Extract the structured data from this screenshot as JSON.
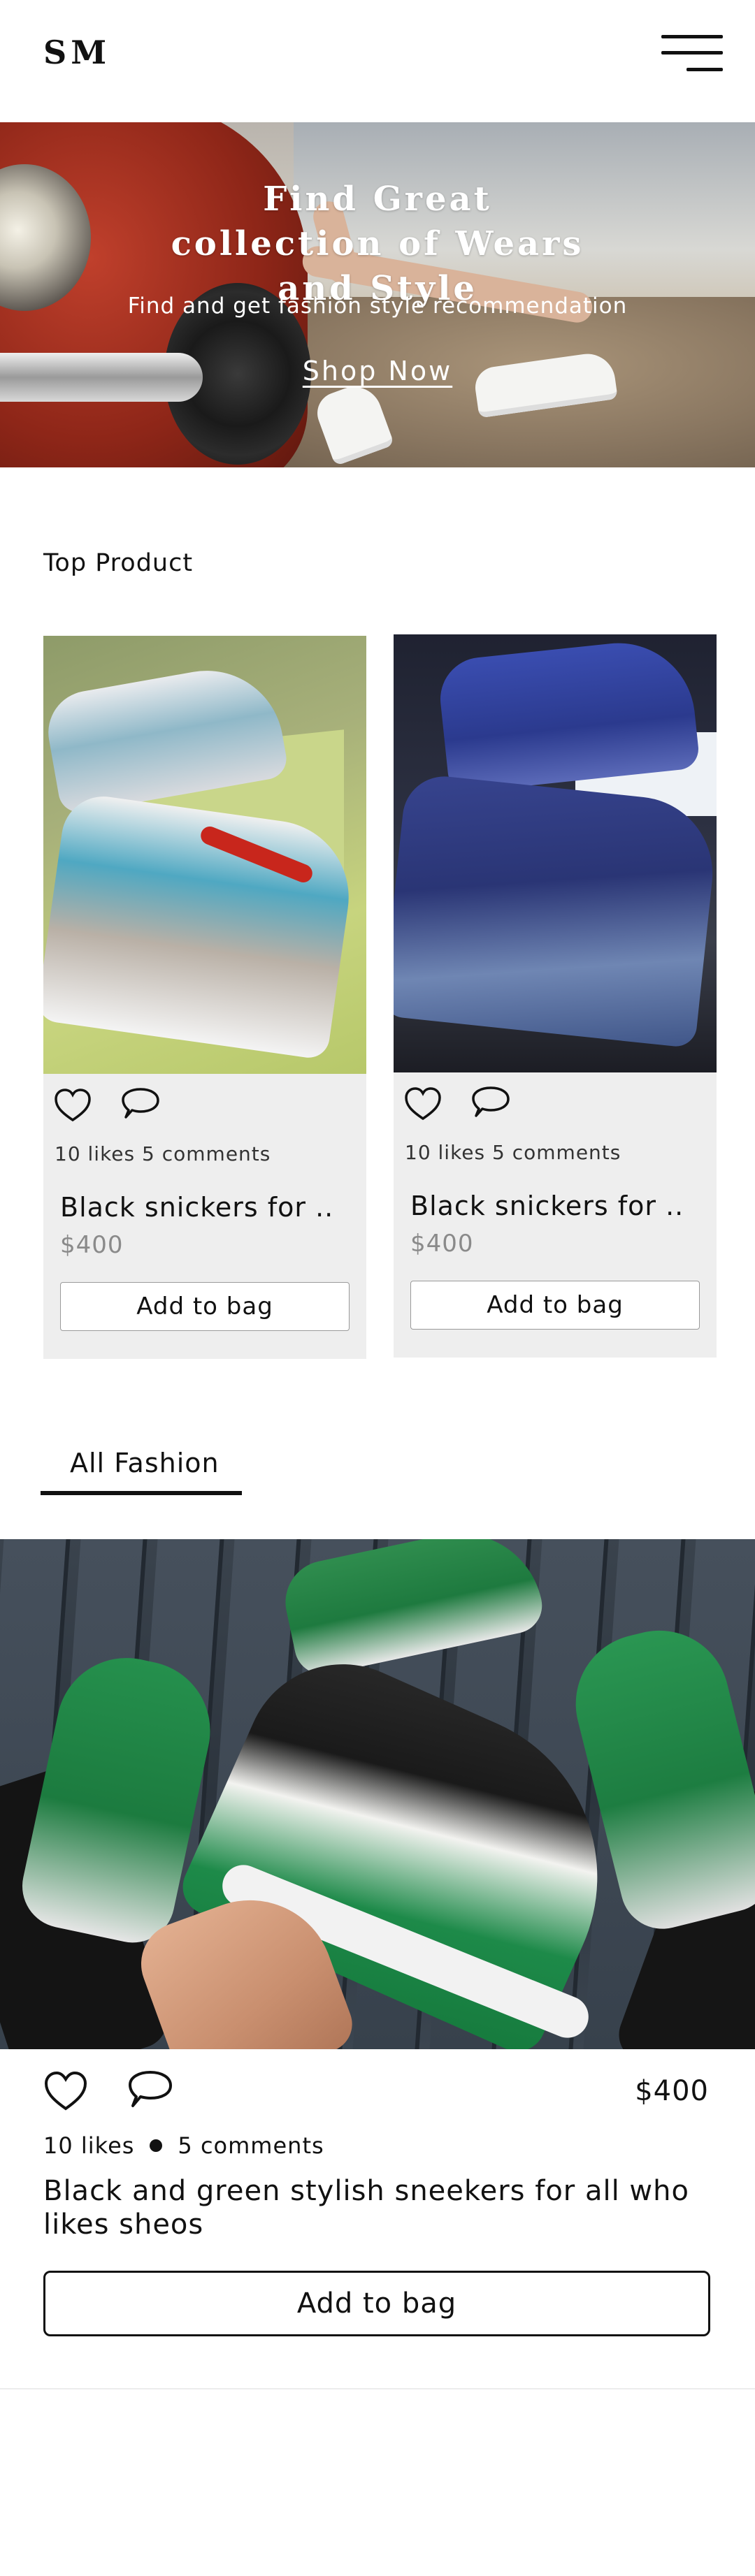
{
  "header": {
    "logo": "SM",
    "menu_icon": "hamburger-menu-icon"
  },
  "hero": {
    "title": "Find Great collection of Wears and Style",
    "subtitle": "Find and get fashion style recommendation",
    "cta": "Shop Now"
  },
  "top_products": {
    "heading": "Top Product",
    "items": [
      {
        "likes": "10 likes",
        "comments": "5 comments",
        "title": "Black snickers for ..",
        "price": "$400",
        "button": "Add to bag",
        "like_icon": "heart-icon",
        "comment_icon": "comment-icon"
      },
      {
        "likes": "10 likes",
        "comments": "5 comments",
        "title": "Black snickers for ..",
        "price": "$400",
        "button": "Add to bag",
        "like_icon": "heart-icon",
        "comment_icon": "comment-icon"
      }
    ]
  },
  "all_fashion": {
    "tab_label": "All Fashion",
    "featured": {
      "price": "$400",
      "likes": "10 likes",
      "comments": "5 comments",
      "title": "Black and green stylish  sneekers for all who likes sheos",
      "button": "Add to bag",
      "like_icon": "heart-icon",
      "comment_icon": "comment-icon"
    }
  }
}
